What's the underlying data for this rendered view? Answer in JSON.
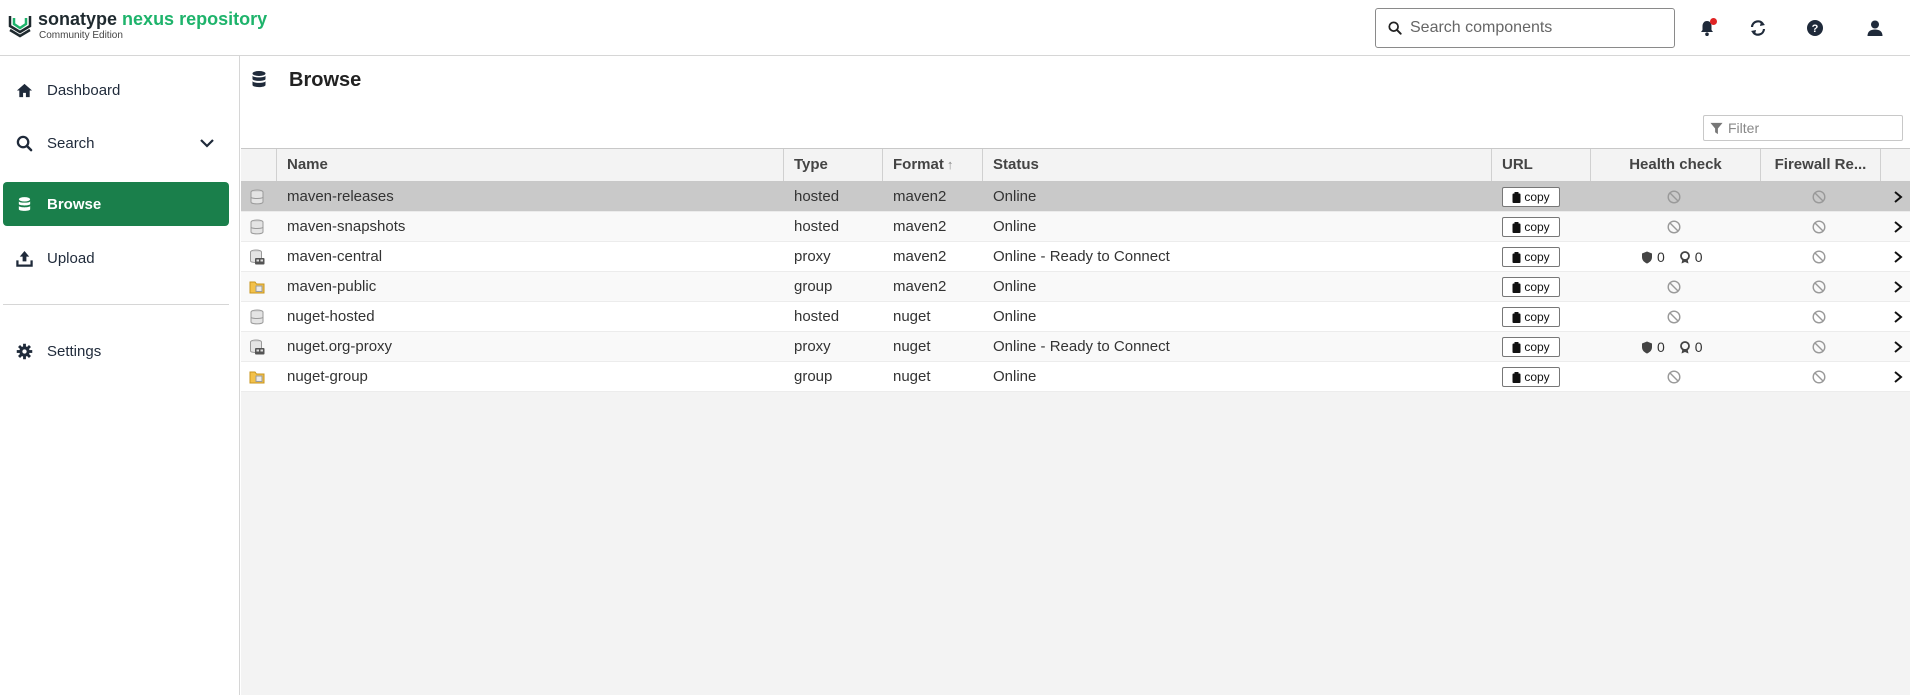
{
  "header": {
    "brand_part1": "sonatype",
    "brand_part2": "nexus repository",
    "edition": "Community Edition",
    "search_placeholder": "Search components"
  },
  "sidebar": {
    "items": [
      {
        "label": "Dashboard",
        "icon": "home-icon"
      },
      {
        "label": "Search",
        "icon": "search-icon"
      },
      {
        "label": "Browse",
        "icon": "database-icon",
        "active": true
      },
      {
        "label": "Upload",
        "icon": "upload-icon"
      },
      {
        "label": "Settings",
        "icon": "gear-icon"
      }
    ]
  },
  "main": {
    "title": "Browse",
    "filter_placeholder": "Filter",
    "columns": {
      "name": "Name",
      "type": "Type",
      "format": "Format",
      "status": "Status",
      "url": "URL",
      "health": "Health check",
      "firewall": "Firewall Re..."
    },
    "sort_indicator": "↑",
    "copy_label": "copy",
    "rows": [
      {
        "name": "maven-releases",
        "type": "hosted",
        "format": "maven2",
        "status": "Online",
        "health": null
      },
      {
        "name": "maven-snapshots",
        "type": "hosted",
        "format": "maven2",
        "status": "Online",
        "health": null
      },
      {
        "name": "maven-central",
        "type": "proxy",
        "format": "maven2",
        "status": "Online - Ready to Connect",
        "health": {
          "security": "0",
          "license": "0"
        }
      },
      {
        "name": "maven-public",
        "type": "group",
        "format": "maven2",
        "status": "Online",
        "health": null
      },
      {
        "name": "nuget-hosted",
        "type": "hosted",
        "format": "nuget",
        "status": "Online",
        "health": null
      },
      {
        "name": "nuget.org-proxy",
        "type": "proxy",
        "format": "nuget",
        "status": "Online - Ready to Connect",
        "health": {
          "security": "0",
          "license": "0"
        }
      },
      {
        "name": "nuget-group",
        "type": "group",
        "format": "nuget",
        "status": "Online",
        "health": null
      }
    ]
  },
  "colors": {
    "brand_green": "#1eb36b",
    "nav_active": "#1a7f4b",
    "selected_row": "#c9c9c9"
  }
}
